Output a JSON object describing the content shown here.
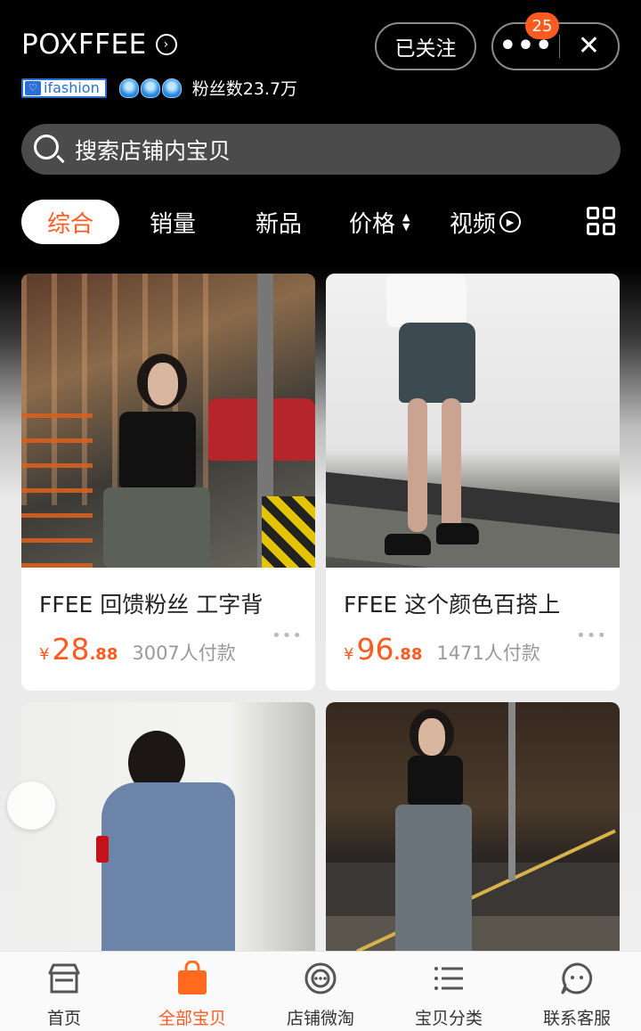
{
  "header": {
    "store_name": "POXFFEE",
    "brand_badge": "ifashion",
    "fans": "粉丝数23.7万",
    "follow_label": "已关注",
    "more_label": "•••",
    "notification_count": "25",
    "close_label": "✕"
  },
  "search": {
    "placeholder": "搜索店铺内宝贝"
  },
  "tabs": [
    {
      "label": "综合"
    },
    {
      "label": "销量"
    },
    {
      "label": "新品"
    },
    {
      "label": "价格"
    },
    {
      "label": "视频"
    }
  ],
  "products": [
    {
      "title": "FFEE 回馈粉丝 工字背",
      "currency": "¥",
      "price_int": "28",
      "price_dec": ".88",
      "sold": "3007人付款"
    },
    {
      "title": "FFEE 这个颜色百搭上",
      "currency": "¥",
      "price_int": "96",
      "price_dec": ".88",
      "sold": "1471人付款"
    }
  ],
  "bottom_nav": [
    {
      "label": "首页"
    },
    {
      "label": "全部宝贝"
    },
    {
      "label": "店铺微淘"
    },
    {
      "label": "宝贝分类"
    },
    {
      "label": "联系客服"
    }
  ],
  "colors": {
    "accent": "#ff5a1f",
    "background_top": "#000000",
    "background_bottom": "#efefef"
  }
}
